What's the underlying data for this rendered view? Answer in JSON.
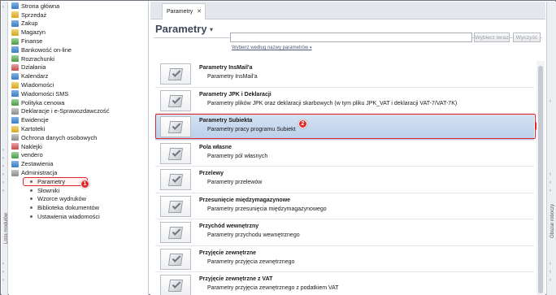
{
  "left_rail": {
    "label": "Lista modułów"
  },
  "right_rail": {
    "label": "Obszar roboczy"
  },
  "modules": [
    {
      "label": "Strona główna",
      "icon": "home-icon",
      "ico": "ico-a"
    },
    {
      "label": "Sprzedaż",
      "icon": "sales-icon",
      "ico": "ico-b"
    },
    {
      "label": "Zakup",
      "icon": "purchase-icon",
      "ico": "ico-a"
    },
    {
      "label": "Magazyn",
      "icon": "warehouse-icon",
      "ico": "ico-b"
    },
    {
      "label": "Finanse",
      "icon": "finance-icon",
      "ico": "ico-c"
    },
    {
      "label": "Bankowość on-line",
      "icon": "bank-icon",
      "ico": "ico-a"
    },
    {
      "label": "Rozrachunki",
      "icon": "settlements-icon",
      "ico": "ico-c"
    },
    {
      "label": "Działania",
      "icon": "actions-icon",
      "ico": "ico-d"
    },
    {
      "label": "Kalendarz",
      "icon": "calendar-icon",
      "ico": "ico-a"
    },
    {
      "label": "Wiadomości",
      "icon": "messages-icon",
      "ico": "ico-b"
    },
    {
      "label": "Wiadomości SMS",
      "icon": "sms-icon",
      "ico": "ico-a"
    },
    {
      "label": "Polityka cenowa",
      "icon": "pricing-icon",
      "ico": "ico-c"
    },
    {
      "label": "Deklaracje i e-Sprawozdawczość",
      "icon": "declarations-icon",
      "ico": "ico-e"
    },
    {
      "label": "Ewidencje",
      "icon": "records-icon",
      "ico": "ico-a"
    },
    {
      "label": "Kartoteki",
      "icon": "files-icon",
      "ico": "ico-b"
    },
    {
      "label": "Ochrona danych osobowych",
      "icon": "data-protection-icon",
      "ico": "ico-e"
    },
    {
      "label": "Naklejki",
      "icon": "stickers-icon",
      "ico": "ico-d"
    },
    {
      "label": "vendero",
      "icon": "vendero-icon",
      "ico": "ico-c"
    },
    {
      "label": "Zestawienia",
      "icon": "reports-icon",
      "ico": "ico-a"
    },
    {
      "label": "Administracja",
      "icon": "admin-icon",
      "ico": "ico-e"
    }
  ],
  "admin_sub": [
    {
      "label": "Parametry",
      "selected": true
    },
    {
      "label": "Słowniki"
    },
    {
      "label": "Wzorce wydruków"
    },
    {
      "label": "Biblioteka dokumentów"
    },
    {
      "label": "Ustawienia wiadomości"
    }
  ],
  "callout_1": "1",
  "callout_2": "2",
  "tab": {
    "label": "Parametry",
    "close": "✕"
  },
  "main": {
    "title": "Parametry",
    "title_caret": "▾",
    "search": {
      "value": "",
      "placeholder": ""
    },
    "search_button": "Wybierz teraz",
    "clear_button": "Wyczyść",
    "search_hint": "Wybierz według nazwy parametrów",
    "search_hint_caret": "▾"
  },
  "params": [
    {
      "title": "Parametry InsMail'a",
      "desc": "Parametry InsMail'a"
    },
    {
      "title": "Parametry JPK i Deklaracji",
      "desc": "Parametry plików JPK oraz deklaracji skarbowych (w tym pliku JPK_VAT i deklaracji VAT-7/VAT-7K)"
    },
    {
      "title": "Parametry Subiekta",
      "desc": "Parametry pracy programu Subiekt",
      "selected": true
    },
    {
      "title": "Pola własne",
      "desc": "Parametry pól własnych"
    },
    {
      "title": "Przelewy",
      "desc": "Parametry przelewów"
    },
    {
      "title": "Przesunięcie międzymagazynowe",
      "desc": "Parametry przesunięcia międzymagazynowego"
    },
    {
      "title": "Przychód wewnętrzny",
      "desc": "Parametry przychodu wewnętrznego"
    },
    {
      "title": "Przyjęcie zewnętrzne",
      "desc": "Parametry przyjęcia zewnętrznego"
    },
    {
      "title": "Przyjęcie zewnętrzne z VAT",
      "desc": "Parametry przyjęcia zewnętrznego z podatkiem VAT"
    }
  ],
  "colors": {
    "accent_red": "#e2262b",
    "selection_blue": "#c4d7ee",
    "title": "#3d4b5c"
  }
}
